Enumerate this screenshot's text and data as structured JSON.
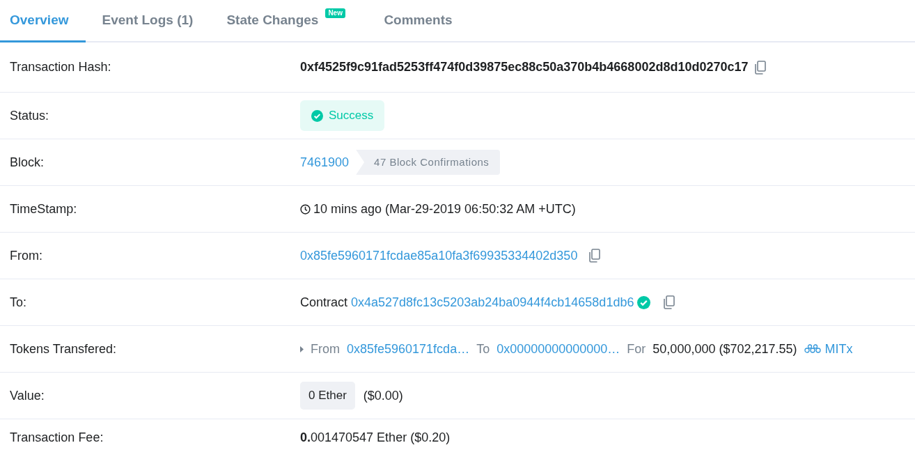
{
  "tabs": [
    {
      "label": "Overview",
      "selected": true
    },
    {
      "label": "Event Logs (1)",
      "selected": false
    },
    {
      "label": "State Changes",
      "selected": false,
      "badge": "New"
    },
    {
      "label": "Comments",
      "selected": false
    }
  ],
  "rows": [
    {
      "kind": "hash",
      "label": "Transaction Hash:",
      "value": "0xf4525f9c91fad5253ff474f0d39875ec88c50a370b4b4668002d8d10d0270c17"
    },
    {
      "kind": "status",
      "label": "Status:",
      "value": "Success"
    },
    {
      "kind": "block",
      "label": "Block:",
      "value": "7461900",
      "confirmations": "47 Block Confirmations"
    },
    {
      "kind": "timestamp",
      "label": "TimeStamp:",
      "value": "10 mins ago (Mar-29-2019 06:50:32 AM +UTC)"
    },
    {
      "kind": "address",
      "label": "From:",
      "value": "0x85fe5960171fcdae85a10fa3f69935334402d350"
    },
    {
      "kind": "contract",
      "label": "To:",
      "prefix": "Contract",
      "value": "0x4a527d8fc13c5203ab24ba0944f4cb14658d1db6"
    },
    {
      "kind": "tokens",
      "label": "Tokens Transfered:",
      "from_label": "From",
      "from": "0x85fe5960171fcda…",
      "to_label": "To",
      "to": "0x00000000000000…",
      "for_label": "For",
      "amount": "50,000,000 ($702,217.55)",
      "token": "MITx"
    },
    {
      "kind": "value",
      "label": "Value:",
      "value": "0 Ether",
      "usd": "($0.00)"
    },
    {
      "kind": "fee",
      "label": "Transaction Fee:",
      "value": "**0.**001470547 Ether ($0.20)"
    }
  ]
}
